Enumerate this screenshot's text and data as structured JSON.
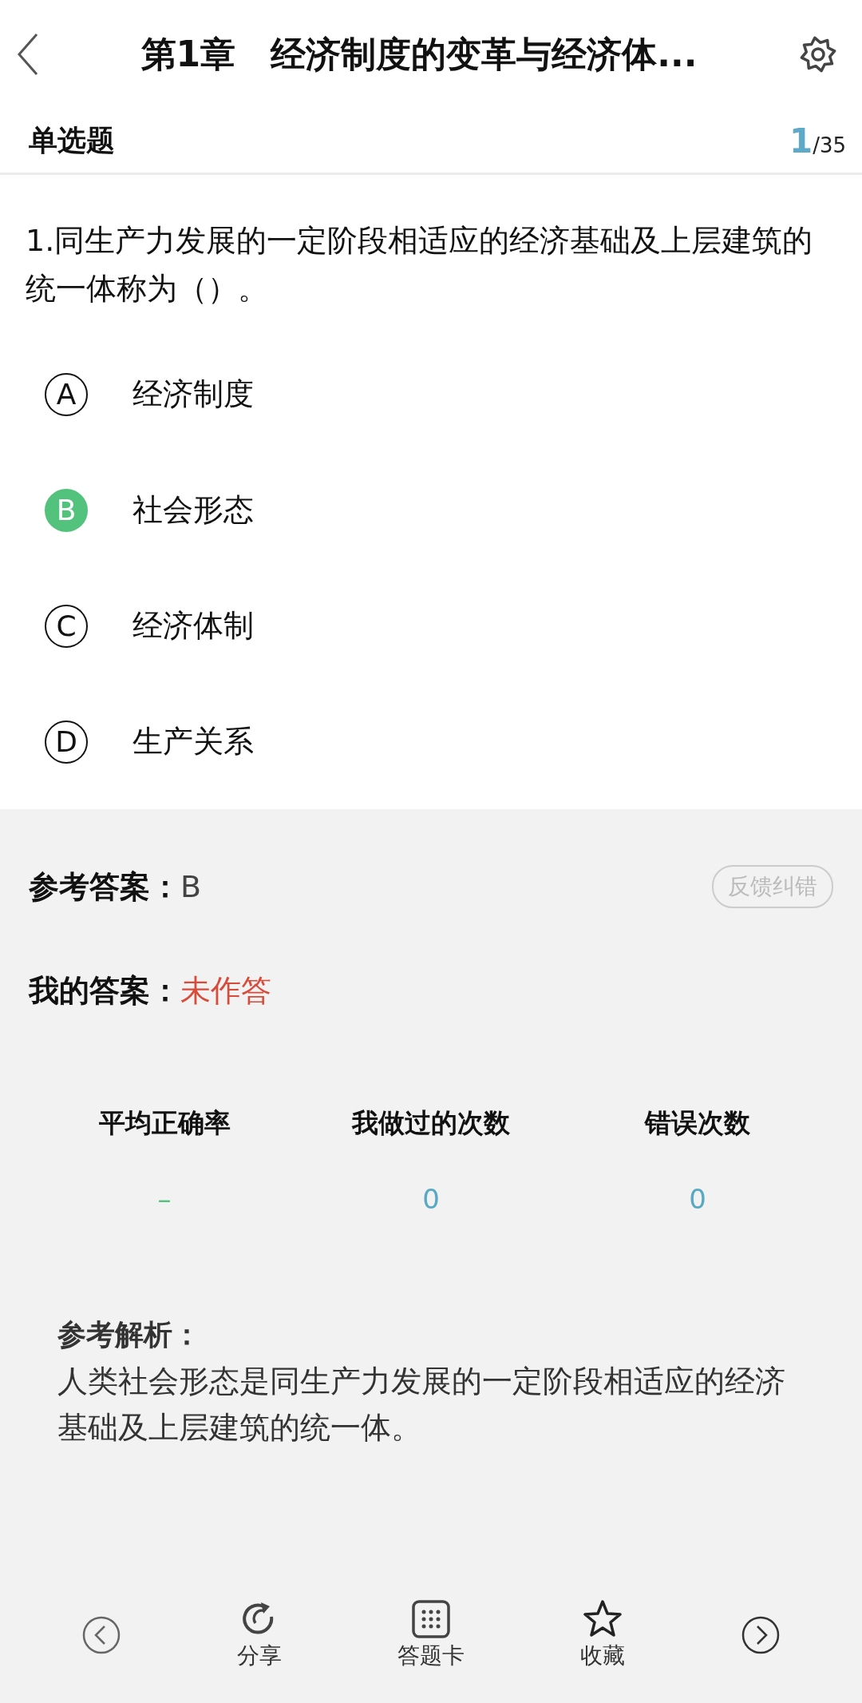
{
  "header": {
    "title": "第1章　经济制度的变革与经济体..."
  },
  "section": {
    "type": "单选题",
    "current": "1",
    "total": "/35"
  },
  "question": {
    "text": "1.同生产力发展的一定阶段相适应的经济基础及上层建筑的统一体称为（）。",
    "options": [
      {
        "letter": "A",
        "text": "经济制度",
        "selected": false
      },
      {
        "letter": "B",
        "text": "社会形态",
        "selected": true
      },
      {
        "letter": "C",
        "text": "经济体制",
        "selected": false
      },
      {
        "letter": "D",
        "text": "生产关系",
        "selected": false
      }
    ]
  },
  "answer": {
    "reference_label": "参考答案：",
    "reference_value": "B",
    "feedback_button": "反馈纠错",
    "mine_label": "我的答案：",
    "mine_value": "未作答"
  },
  "stats": [
    {
      "label": "平均正确率",
      "value": "–",
      "kind": "dash"
    },
    {
      "label": "我做过的次数",
      "value": "0",
      "kind": "number"
    },
    {
      "label": "错误次数",
      "value": "0",
      "kind": "number"
    }
  ],
  "analysis": {
    "label": "参考解析：",
    "text": "人类社会形态是同生产力发展的一定阶段相适应的经济基础及上层建筑的统一体。"
  },
  "toolbar": [
    {
      "kind": "prev"
    },
    {
      "kind": "share",
      "label": "分享"
    },
    {
      "kind": "card",
      "label": "答题卡"
    },
    {
      "kind": "star",
      "label": "收藏"
    },
    {
      "kind": "next"
    }
  ]
}
